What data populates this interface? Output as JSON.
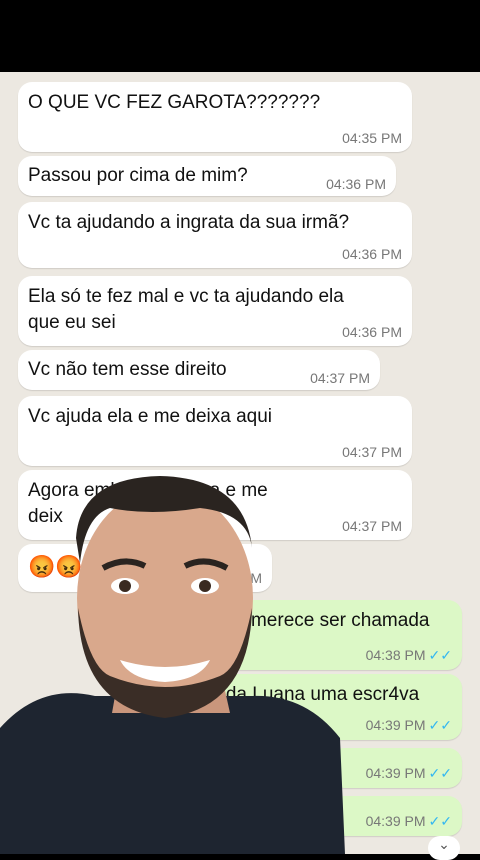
{
  "incoming": [
    {
      "text": "O QUE VC FEZ GAROTA???????",
      "time": "04:35 PM"
    },
    {
      "text": "Passou por cima de mim?",
      "time": "04:36 PM"
    },
    {
      "text": "Vc ta ajudando a ingrata da sua irmã?",
      "time": "04:36 PM"
    },
    {
      "text": "Ela só te fez mal e vc ta ajudando ela\nque eu sei",
      "time": "04:36 PM"
    },
    {
      "text": "Vc não tem esse direito",
      "time": "04:37 PM"
    },
    {
      "text": "Vc ajuda ela e me deixa aqui",
      "time": "04:37 PM"
    },
    {
      "text": "Agora          embora de casa e me\ndeix",
      "time": "04:37 PM"
    },
    {
      "text": "😡😡",
      "time": "38 PM"
    }
  ],
  "outgoing": [
    {
      "text": "não merece ser chamada",
      "time": "04:38 PM"
    },
    {
      "text": "o da Luana uma escr4va",
      "time": "04:39 PM"
    },
    {
      "text": "",
      "time": "04:39 PM"
    },
    {
      "text": "",
      "time": "04:39 PM"
    }
  ],
  "tick_glyph": "✓✓",
  "colors": {
    "chat_bg": "#ece8e1",
    "incoming": "#ffffff",
    "outgoing": "#dcf8c6",
    "read_ticks": "#34b7f1"
  },
  "scroll_icon": "⌄"
}
